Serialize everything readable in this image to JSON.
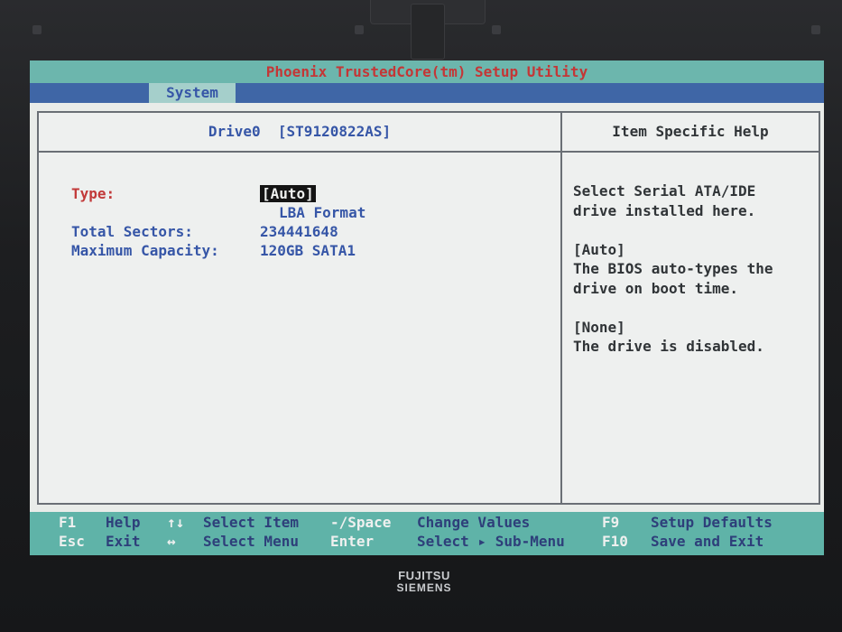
{
  "title": "Phoenix TrustedCore(tm) Setup Utility",
  "menu": {
    "active_tab": "System"
  },
  "left_panel": {
    "header": "Drive0  [ST9120822AS]",
    "fields": {
      "type_label": "Type:",
      "type_value": "[Auto]",
      "lba_value": "LBA Format",
      "sectors_label": "Total Sectors:",
      "sectors_value": "234441648",
      "capacity_label": "Maximum Capacity:",
      "capacity_value": "120GB SATA1"
    }
  },
  "right_panel": {
    "header": "Item Specific Help",
    "help_lines": [
      "Select Serial ATA/IDE",
      "drive installed here.",
      "",
      "[Auto]",
      "The BIOS auto-types the",
      "drive on boot time.",
      "",
      "[None]",
      "The drive is disabled."
    ]
  },
  "footer": {
    "row1": {
      "k1": "F1",
      "d1": "Help",
      "k2": "↑↓",
      "d2": "Select Item",
      "k3": "-/Space",
      "d3": "Change Values",
      "k4": "F9",
      "d4": "Setup Defaults"
    },
    "row2": {
      "k1": "Esc",
      "d1": "Exit",
      "k2": "↔",
      "d2": "Select Menu",
      "k3": "Enter",
      "d3": "Select ▸ Sub-Menu",
      "k4": "F10",
      "d4": "Save and Exit"
    }
  },
  "bezel": {
    "brand_top": "FUJITSU",
    "brand_bottom": "SIEMENS"
  },
  "colors": {
    "title_bar": "#6cb6ad",
    "menu_bar": "#3f66a6",
    "panel_bg": "#eef0ef",
    "field_blue": "#3656a7",
    "field_red": "#c23a3a",
    "footer_bg": "#5fb3a8"
  }
}
